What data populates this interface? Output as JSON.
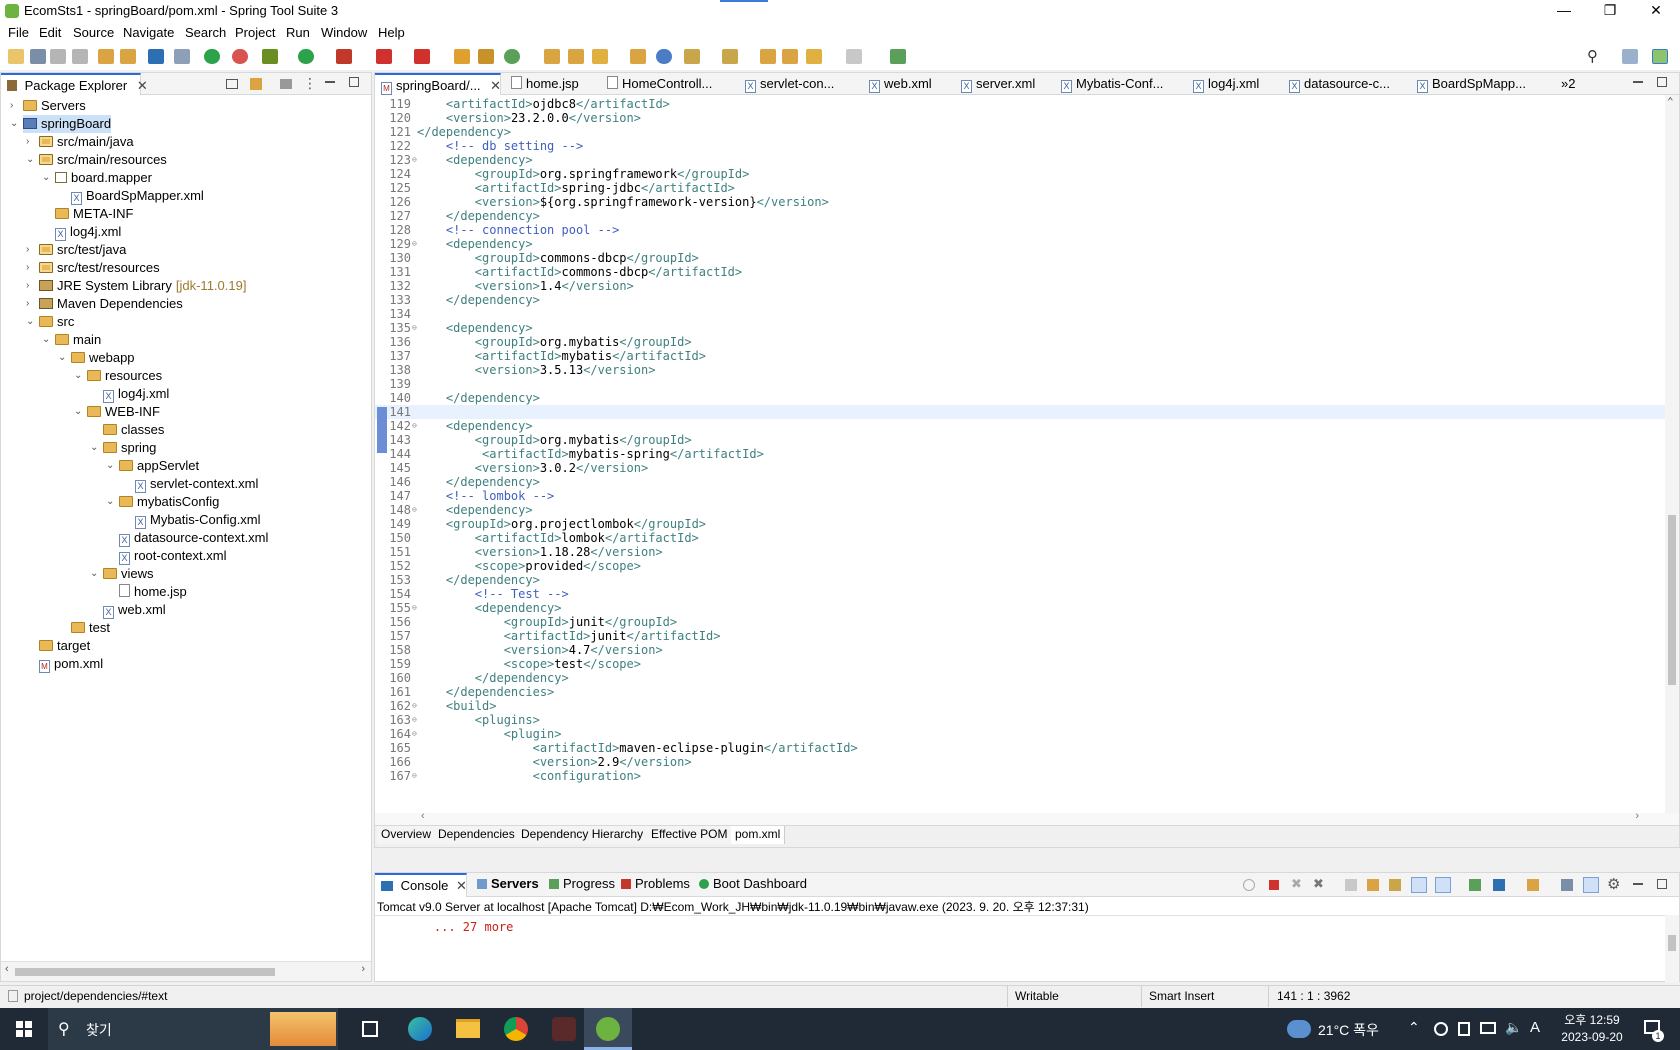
{
  "window": {
    "title": "EcomSts1 - springBoard/pom.xml - Spring Tool Suite 3",
    "minimize": "—",
    "restore": "❐",
    "close": "✕"
  },
  "menu": [
    "File",
    "Edit",
    "Source",
    "Navigate",
    "Search",
    "Project",
    "Run",
    "Window",
    "Help"
  ],
  "explorer": {
    "tab_label": "Package Explorer",
    "tree": [
      {
        "label": "Servers",
        "icon": "folder-icon",
        "twisty": "›"
      },
      {
        "label": "springBoard",
        "icon": "project-icon",
        "twisty": "⌄",
        "selected": true
      },
      {
        "label": "src/main/java",
        "icon": "package-folder-icon",
        "twisty": "›"
      },
      {
        "label": "src/main/resources",
        "icon": "package-folder-icon",
        "twisty": "⌄"
      },
      {
        "label": "board.mapper",
        "icon": "package-icon",
        "twisty": "⌄"
      },
      {
        "label": "BoardSpMapper.xml",
        "icon": "xml-file-icon"
      },
      {
        "label": "META-INF",
        "icon": "folder-icon"
      },
      {
        "label": "log4j.xml",
        "icon": "xml-file-icon"
      },
      {
        "label": "src/test/java",
        "icon": "package-folder-icon",
        "twisty": "›"
      },
      {
        "label": "src/test/resources",
        "icon": "package-folder-icon",
        "twisty": "›"
      },
      {
        "label": "JRE System Library",
        "suffix": "[jdk-11.0.19]",
        "icon": "library-icon",
        "twisty": "›"
      },
      {
        "label": "Maven Dependencies",
        "icon": "library-icon",
        "twisty": "›"
      },
      {
        "label": "src",
        "icon": "folder-icon",
        "twisty": "⌄"
      },
      {
        "label": "main",
        "icon": "folder-icon",
        "twisty": "⌄"
      },
      {
        "label": "webapp",
        "icon": "folder-icon",
        "twisty": "⌄"
      },
      {
        "label": "resources",
        "icon": "folder-icon",
        "twisty": "⌄"
      },
      {
        "label": "log4j.xml",
        "icon": "xml-file-icon"
      },
      {
        "label": "WEB-INF",
        "icon": "folder-icon",
        "twisty": "⌄"
      },
      {
        "label": "classes",
        "icon": "folder-icon"
      },
      {
        "label": "spring",
        "icon": "folder-icon",
        "twisty": "⌄"
      },
      {
        "label": "appServlet",
        "icon": "folder-icon",
        "twisty": "⌄"
      },
      {
        "label": "servlet-context.xml",
        "icon": "xml-file-icon"
      },
      {
        "label": "mybatisConfig",
        "icon": "folder-icon",
        "twisty": "⌄"
      },
      {
        "label": "Mybatis-Config.xml",
        "icon": "xml-file-icon"
      },
      {
        "label": "datasource-context.xml",
        "icon": "xml-file-icon"
      },
      {
        "label": "root-context.xml",
        "icon": "xml-file-icon"
      },
      {
        "label": "views",
        "icon": "folder-icon",
        "twisty": "⌄"
      },
      {
        "label": "home.jsp",
        "icon": "jsp-file-icon"
      },
      {
        "label": "web.xml",
        "icon": "xml-file-icon"
      },
      {
        "label": "test",
        "icon": "folder-icon"
      },
      {
        "label": "target",
        "icon": "folder-icon"
      },
      {
        "label": "pom.xml",
        "icon": "pom-file-icon"
      }
    ]
  },
  "editor": {
    "tabs": [
      "springBoard/...",
      "home.jsp",
      "HomeControll...",
      "servlet-con...",
      "web.xml",
      "server.xml",
      "Mybatis-Conf...",
      "log4j.xml",
      "datasource-c...",
      "BoardSpMapp..."
    ],
    "overflow": "»2",
    "current_line": "141",
    "lines": [
      {
        "n": "119",
        "code": "    <artifactId>ojdbc8</artifactId>"
      },
      {
        "n": "120",
        "code": "    <version>23.2.0.0</version>"
      },
      {
        "n": "121",
        "code": "</dependency>"
      },
      {
        "n": "122",
        "code": "    <!-- db setting -->"
      },
      {
        "n": "123",
        "code": "    <dependency>",
        "fold": true
      },
      {
        "n": "124",
        "code": "        <groupId>org.springframework</groupId>"
      },
      {
        "n": "125",
        "code": "        <artifactId>spring-jdbc</artifactId>"
      },
      {
        "n": "126",
        "code": "        <version>${org.springframework-version}</version>"
      },
      {
        "n": "127",
        "code": "    </dependency>"
      },
      {
        "n": "128",
        "code": "    <!-- connection pool -->"
      },
      {
        "n": "129",
        "code": "    <dependency>",
        "fold": true
      },
      {
        "n": "130",
        "code": "        <groupId>commons-dbcp</groupId>"
      },
      {
        "n": "131",
        "code": "        <artifactId>commons-dbcp</artifactId>"
      },
      {
        "n": "132",
        "code": "        <version>1.4</version>"
      },
      {
        "n": "133",
        "code": "    </dependency>"
      },
      {
        "n": "134",
        "code": ""
      },
      {
        "n": "135",
        "code": "    <dependency>",
        "fold": true
      },
      {
        "n": "136",
        "code": "        <groupId>org.mybatis</groupId>"
      },
      {
        "n": "137",
        "code": "        <artifactId>mybatis</artifactId>"
      },
      {
        "n": "138",
        "code": "        <version>3.5.13</version>"
      },
      {
        "n": "139",
        "code": ""
      },
      {
        "n": "140",
        "code": "    </dependency>"
      },
      {
        "n": "141",
        "code": ""
      },
      {
        "n": "142",
        "code": "    <dependency>",
        "fold": true
      },
      {
        "n": "143",
        "code": "        <groupId>org.mybatis</groupId>"
      },
      {
        "n": "144",
        "code": "         <artifactId>mybatis-spring</artifactId>"
      },
      {
        "n": "145",
        "code": "        <version>3.0.2</version>"
      },
      {
        "n": "146",
        "code": "    </dependency>"
      },
      {
        "n": "147",
        "code": "    <!-- lombok -->"
      },
      {
        "n": "148",
        "code": "    <dependency>",
        "fold": true
      },
      {
        "n": "149",
        "code": "    <groupId>org.projectlombok</groupId>"
      },
      {
        "n": "150",
        "code": "        <artifactId>lombok</artifactId>"
      },
      {
        "n": "151",
        "code": "        <version>1.18.28</version>"
      },
      {
        "n": "152",
        "code": "        <scope>provided</scope>"
      },
      {
        "n": "153",
        "code": "    </dependency>"
      },
      {
        "n": "154",
        "code": "        <!-- Test -->"
      },
      {
        "n": "155",
        "code": "        <dependency>",
        "fold": true
      },
      {
        "n": "156",
        "code": "            <groupId>junit</groupId>"
      },
      {
        "n": "157",
        "code": "            <artifactId>junit</artifactId>"
      },
      {
        "n": "158",
        "code": "            <version>4.7</version>"
      },
      {
        "n": "159",
        "code": "            <scope>test</scope>"
      },
      {
        "n": "160",
        "code": "        </dependency>"
      },
      {
        "n": "161",
        "code": "    </dependencies>"
      },
      {
        "n": "162",
        "code": "    <build>",
        "fold": true
      },
      {
        "n": "163",
        "code": "        <plugins>",
        "fold": true
      },
      {
        "n": "164",
        "code": "            <plugin>",
        "fold": true
      },
      {
        "n": "165",
        "code": "                <artifactId>maven-eclipse-plugin</artifactId>"
      },
      {
        "n": "166",
        "code": "                <version>2.9</version>"
      },
      {
        "n": "167",
        "code": "                <configuration>",
        "fold": true
      }
    ],
    "pom_tabs": [
      "Overview",
      "Dependencies",
      "Dependency Hierarchy",
      "Effective POM",
      "pom.xml"
    ]
  },
  "console": {
    "tabs": [
      "Console",
      "Servers",
      "Progress",
      "Problems",
      "Boot Dashboard"
    ],
    "header": "Tomcat v9.0 Server at localhost [Apache Tomcat] D:₩Ecom_Work_JH₩bin₩jdk-11.0.19₩bin₩javaw.exe  (2023. 9. 20. 오후 12:37:31)",
    "output": "    ... 27 more"
  },
  "status": {
    "path": "project/dependencies/#text",
    "writable": "Writable",
    "insert_mode": "Smart Insert",
    "position": "141 : 1 : 3962"
  },
  "taskbar": {
    "search_label": "찾기",
    "weather": "21°C  폭우",
    "time": "오후 12:59",
    "date": "2023-09-20",
    "ime": "A",
    "notif_count": "1"
  },
  "colors": {
    "accent": "#2d6ad9",
    "tag": "#3f7f7f",
    "comment": "#3f5fbf",
    "taskbar": "#1f2a36"
  }
}
